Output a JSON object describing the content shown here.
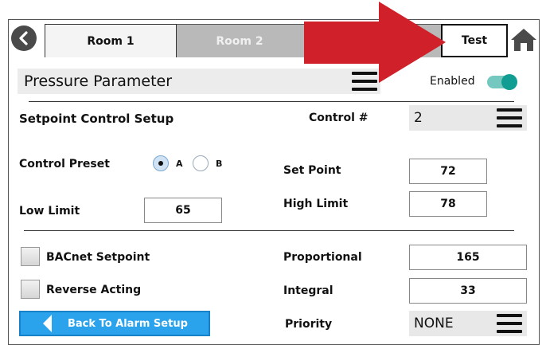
{
  "tabs": {
    "room1": "Room 1",
    "room2": "Room 2",
    "test": "Test"
  },
  "header": {
    "parameter_select": "Pressure Parameter",
    "enabled_label": "Enabled",
    "enabled_on": true
  },
  "setpoint_control": {
    "section_title": "Setpoint Control Setup",
    "control_num_label": "Control #",
    "control_num_value": "2",
    "control_preset_label": "Control Preset",
    "preset_a": "A",
    "preset_b": "B",
    "preset_selected": "A",
    "set_point_label": "Set Point",
    "set_point_value": "72",
    "low_limit_label": "Low Limit",
    "low_limit_value": "65",
    "high_limit_label": "High Limit",
    "high_limit_value": "78"
  },
  "pid": {
    "bacnet_setpoint_label": "BACnet Setpoint",
    "reverse_acting_label": "Reverse Acting",
    "proportional_label": "Proportional",
    "proportional_value": "165",
    "integral_label": "Integral",
    "integral_value": "33",
    "priority_label": "Priority",
    "priority_value": "NONE"
  },
  "footer": {
    "back_button": "Back To Alarm Setup"
  },
  "colors": {
    "toggle_on": "#129d92",
    "back_button": "#2aa2ec",
    "annotation_arrow": "#d0202a"
  }
}
